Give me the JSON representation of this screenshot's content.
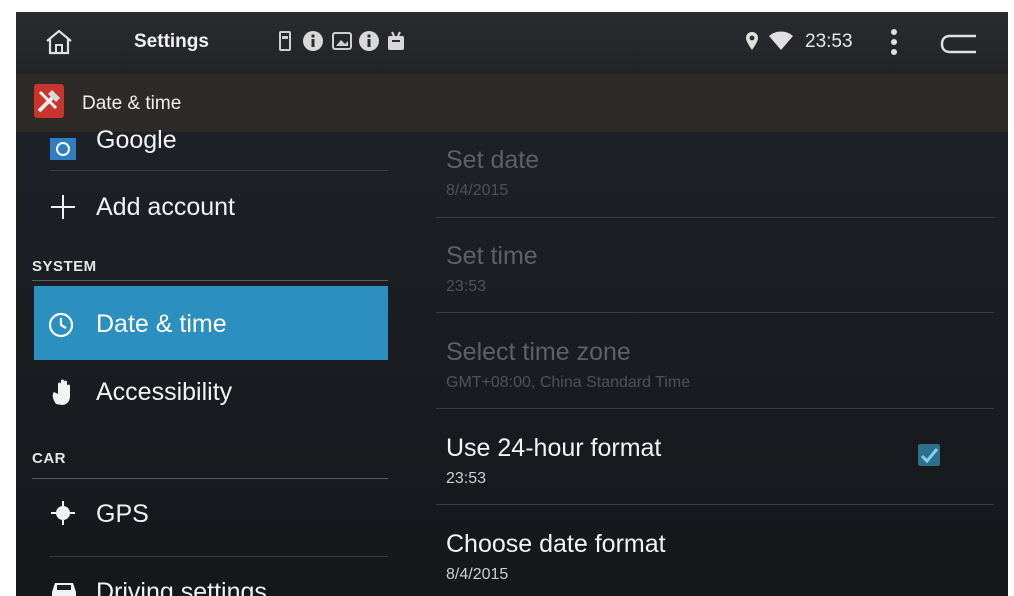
{
  "status_bar": {
    "app_title": "Settings",
    "clock": "23:53",
    "notification_icons": [
      "sd-card-icon",
      "info-icon",
      "image-icon",
      "info-icon",
      "android-icon"
    ]
  },
  "action_bar": {
    "title": "Date & time"
  },
  "sidebar": {
    "top_item": "Google",
    "add_account": "Add account",
    "section_system": "SYSTEM",
    "items_system": [
      {
        "label": "Date & time",
        "icon": "clock-icon",
        "selected": true
      },
      {
        "label": "Accessibility",
        "icon": "hand-icon",
        "selected": false
      }
    ],
    "section_car": "CAR",
    "items_car": [
      {
        "label": "GPS",
        "icon": "gps-icon"
      },
      {
        "label": "Driving settings",
        "icon": "car-icon"
      }
    ]
  },
  "preferences": [
    {
      "title": "Set date",
      "summary": "8/4/2015",
      "enabled": false
    },
    {
      "title": "Set time",
      "summary": "23:53",
      "enabled": false
    },
    {
      "title": "Select time zone",
      "summary": "GMT+08:00, China Standard Time",
      "enabled": false
    },
    {
      "title": "Use 24-hour format",
      "summary": "23:53",
      "enabled": true,
      "checked": true
    },
    {
      "title": "Choose date format",
      "summary": "8/4/2015",
      "enabled": true
    }
  ],
  "colors": {
    "selected_bg": "#2b8fbf",
    "action_bar_bg": "#2e2a28",
    "status_bar_bg": "#2a2b2f"
  }
}
